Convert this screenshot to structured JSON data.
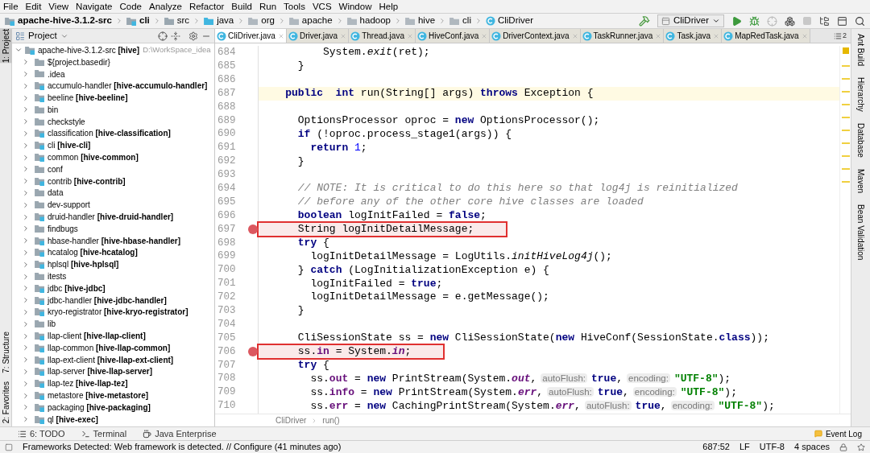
{
  "menu": [
    "File",
    "Edit",
    "View",
    "Navigate",
    "Code",
    "Analyze",
    "Refactor",
    "Build",
    "Run",
    "Tools",
    "VCS",
    "Window",
    "Help"
  ],
  "breadcrumb": [
    {
      "label": "apache-hive-3.1.2-src",
      "kind": "module",
      "bold": true
    },
    {
      "label": "cli",
      "kind": "module",
      "bold": true
    },
    {
      "label": "src",
      "kind": "folder",
      "bold": false
    },
    {
      "label": "java",
      "kind": "source",
      "bold": false
    },
    {
      "label": "org",
      "kind": "package",
      "bold": false
    },
    {
      "label": "apache",
      "kind": "package",
      "bold": false
    },
    {
      "label": "hadoop",
      "kind": "package",
      "bold": false
    },
    {
      "label": "hive",
      "kind": "package",
      "bold": false
    },
    {
      "label": "cli",
      "kind": "package",
      "bold": false
    },
    {
      "label": "CliDriver",
      "kind": "class",
      "bold": false
    }
  ],
  "run_config": "CliDriver",
  "left_strip": {
    "top": [
      {
        "label": "1: Project",
        "selected": true
      }
    ],
    "bottom": [
      {
        "label": "7: Structure",
        "selected": false
      },
      {
        "label": "2: Favorites",
        "selected": false
      }
    ]
  },
  "project_panel": {
    "title": "Project",
    "tree": {
      "name": "apache-hive-3.1.2-src",
      "module": "[hive]",
      "path": "D:\\WorkSpace_idea",
      "expanded": true,
      "children": [
        {
          "name": "${project.basedir}",
          "kind": "folder"
        },
        {
          "name": ".idea",
          "kind": "folder"
        },
        {
          "name": "accumulo-handler",
          "module": "[hive-accumulo-handler]",
          "kind": "module"
        },
        {
          "name": "beeline",
          "module": "[hive-beeline]",
          "kind": "module"
        },
        {
          "name": "bin",
          "kind": "folder"
        },
        {
          "name": "checkstyle",
          "kind": "folder"
        },
        {
          "name": "classification",
          "module": "[hive-classification]",
          "kind": "module"
        },
        {
          "name": "cli",
          "module": "[hive-cli]",
          "kind": "module"
        },
        {
          "name": "common",
          "module": "[hive-common]",
          "kind": "module"
        },
        {
          "name": "conf",
          "kind": "folder"
        },
        {
          "name": "contrib",
          "module": "[hive-contrib]",
          "kind": "module"
        },
        {
          "name": "data",
          "kind": "folder"
        },
        {
          "name": "dev-support",
          "kind": "folder"
        },
        {
          "name": "druid-handler",
          "module": "[hive-druid-handler]",
          "kind": "module"
        },
        {
          "name": "findbugs",
          "kind": "folder"
        },
        {
          "name": "hbase-handler",
          "module": "[hive-hbase-handler]",
          "kind": "module"
        },
        {
          "name": "hcatalog",
          "module": "[hive-hcatalog]",
          "kind": "module"
        },
        {
          "name": "hplsql",
          "module": "[hive-hplsql]",
          "kind": "module"
        },
        {
          "name": "itests",
          "kind": "folder"
        },
        {
          "name": "jdbc",
          "module": "[hive-jdbc]",
          "kind": "module"
        },
        {
          "name": "jdbc-handler",
          "module": "[hive-jdbc-handler]",
          "kind": "module"
        },
        {
          "name": "kryo-registrator",
          "module": "[hive-kryo-registrator]",
          "kind": "module"
        },
        {
          "name": "lib",
          "kind": "folder"
        },
        {
          "name": "llap-client",
          "module": "[hive-llap-client]",
          "kind": "module"
        },
        {
          "name": "llap-common",
          "module": "[hive-llap-common]",
          "kind": "module"
        },
        {
          "name": "llap-ext-client",
          "module": "[hive-llap-ext-client]",
          "kind": "module"
        },
        {
          "name": "llap-server",
          "module": "[hive-llap-server]",
          "kind": "module"
        },
        {
          "name": "llap-tez",
          "module": "[hive-llap-tez]",
          "kind": "module"
        },
        {
          "name": "metastore",
          "module": "[hive-metastore]",
          "kind": "module"
        },
        {
          "name": "packaging",
          "module": "[hive-packaging]",
          "kind": "module"
        },
        {
          "name": "ql",
          "module": "[hive-exec]",
          "kind": "module"
        }
      ]
    }
  },
  "editor_tabs": [
    {
      "label": "CliDriver.java",
      "selected": true
    },
    {
      "label": "Driver.java",
      "selected": false
    },
    {
      "label": "Thread.java",
      "selected": false
    },
    {
      "label": "HiveConf.java",
      "selected": false
    },
    {
      "label": "DriverContext.java",
      "selected": false
    },
    {
      "label": "TaskRunner.java",
      "selected": false
    },
    {
      "label": "Task.java",
      "selected": false
    },
    {
      "label": "MapRedTask.java",
      "selected": false
    }
  ],
  "tab_overflow": "2",
  "code": [
    {
      "number": "684",
      "breakpoint": false,
      "current": false,
      "tokens": [
        {
          "kind": "plain",
          "text": "          System."
        },
        {
          "kind": "static",
          "text": "exit"
        },
        {
          "kind": "plain",
          "text": "(ret);"
        }
      ]
    },
    {
      "number": "685",
      "breakpoint": false,
      "current": false,
      "tokens": [
        {
          "kind": "plain",
          "text": "      }"
        }
      ]
    },
    {
      "number": "686",
      "breakpoint": false,
      "current": false
    },
    {
      "number": "687",
      "breakpoint": false,
      "current": true,
      "tokens": [
        {
          "kind": "keyword",
          "text": "    public"
        },
        {
          "kind": "keyword",
          "text": "  int"
        },
        {
          "kind": "plain",
          "text": " run(String[] args) "
        },
        {
          "kind": "keyword",
          "text": "throws"
        },
        {
          "kind": "plain",
          "text": " Exception {"
        }
      ]
    },
    {
      "number": "688",
      "breakpoint": false,
      "current": false
    },
    {
      "number": "689",
      "breakpoint": false,
      "current": false,
      "tokens": [
        {
          "kind": "plain",
          "text": "      OptionsProcessor oproc = "
        },
        {
          "kind": "keyword",
          "text": "new"
        },
        {
          "kind": "plain",
          "text": " OptionsProcessor();"
        }
      ]
    },
    {
      "number": "690",
      "breakpoint": false,
      "current": false,
      "tokens": [
        {
          "kind": "keyword",
          "text": "      if"
        },
        {
          "kind": "plain",
          "text": " (!oproc.process_stage1(args)) {"
        }
      ]
    },
    {
      "number": "691",
      "breakpoint": false,
      "current": false,
      "tokens": [
        {
          "kind": "keyword",
          "text": "        return"
        },
        {
          "kind": "number",
          "text": " 1"
        },
        {
          "kind": "plain",
          "text": ";"
        }
      ]
    },
    {
      "number": "692",
      "breakpoint": false,
      "current": false,
      "tokens": [
        {
          "kind": "plain",
          "text": "      }"
        }
      ]
    },
    {
      "number": "693",
      "breakpoint": false,
      "current": false
    },
    {
      "number": "694",
      "breakpoint": false,
      "current": false,
      "tokens": [
        {
          "kind": "comment",
          "text": "      // NOTE: It is critical to do this here so that log4j is reinitialized"
        }
      ]
    },
    {
      "number": "695",
      "breakpoint": false,
      "current": false,
      "tokens": [
        {
          "kind": "comment",
          "text": "      // before any of the other core hive classes are loaded"
        }
      ]
    },
    {
      "number": "696",
      "breakpoint": false,
      "current": false,
      "tokens": [
        {
          "kind": "keyword",
          "text": "      boolean"
        },
        {
          "kind": "plain",
          "text": " logInitFailed = "
        },
        {
          "kind": "keyword",
          "text": "false"
        },
        {
          "kind": "plain",
          "text": ";"
        }
      ]
    },
    {
      "number": "697",
      "breakpoint": true,
      "current": false,
      "tokens": [
        {
          "kind": "plain",
          "text": "      String logInitDetailMessage;"
        }
      ]
    },
    {
      "number": "698",
      "breakpoint": false,
      "current": false,
      "tokens": [
        {
          "kind": "keyword",
          "text": "      try"
        },
        {
          "kind": "plain",
          "text": " {"
        }
      ]
    },
    {
      "number": "699",
      "breakpoint": false,
      "current": false,
      "tokens": [
        {
          "kind": "plain",
          "text": "        logInitDetailMessage = LogUtils."
        },
        {
          "kind": "static",
          "text": "initHiveLog4j"
        },
        {
          "kind": "plain",
          "text": "();"
        }
      ]
    },
    {
      "number": "700",
      "breakpoint": false,
      "current": false,
      "tokens": [
        {
          "kind": "plain",
          "text": "      } "
        },
        {
          "kind": "keyword",
          "text": "catch"
        },
        {
          "kind": "plain",
          "text": " (LogInitializationException e) {"
        }
      ]
    },
    {
      "number": "701",
      "breakpoint": false,
      "current": false,
      "tokens": [
        {
          "kind": "plain",
          "text": "        logInitFailed = "
        },
        {
          "kind": "keyword",
          "text": "true"
        },
        {
          "kind": "plain",
          "text": ";"
        }
      ]
    },
    {
      "number": "702",
      "breakpoint": false,
      "current": false,
      "tokens": [
        {
          "kind": "plain",
          "text": "        logInitDetailMessage = e.getMessage();"
        }
      ]
    },
    {
      "number": "703",
      "breakpoint": false,
      "current": false,
      "tokens": [
        {
          "kind": "plain",
          "text": "      }"
        }
      ]
    },
    {
      "number": "704",
      "breakpoint": false,
      "current": false
    },
    {
      "number": "705",
      "breakpoint": false,
      "current": false,
      "tokens": [
        {
          "kind": "plain",
          "text": "      CliSessionState ss = "
        },
        {
          "kind": "keyword",
          "text": "new"
        },
        {
          "kind": "plain",
          "text": " CliSessionState("
        },
        {
          "kind": "keyword",
          "text": "new"
        },
        {
          "kind": "plain",
          "text": " HiveConf(SessionState."
        },
        {
          "kind": "keyword",
          "text": "class"
        },
        {
          "kind": "plain",
          "text": "));"
        }
      ]
    },
    {
      "number": "706",
      "breakpoint": true,
      "current": false,
      "tokens": [
        {
          "kind": "plain",
          "text": "      ss."
        },
        {
          "kind": "field",
          "text": "in"
        },
        {
          "kind": "plain",
          "text": " = System."
        },
        {
          "kind": "static_field",
          "text": "in"
        },
        {
          "kind": "plain",
          "text": ";"
        }
      ]
    },
    {
      "number": "707",
      "breakpoint": false,
      "current": false,
      "tokens": [
        {
          "kind": "keyword",
          "text": "      try"
        },
        {
          "kind": "plain",
          "text": " {"
        }
      ]
    },
    {
      "number": "708",
      "breakpoint": false,
      "current": false,
      "tokens": [
        {
          "kind": "plain",
          "text": "        ss."
        },
        {
          "kind": "field",
          "text": "out"
        },
        {
          "kind": "plain",
          "text": " = "
        },
        {
          "kind": "keyword",
          "text": "new"
        },
        {
          "kind": "plain",
          "text": " PrintStream(System."
        },
        {
          "kind": "static_field",
          "text": "out"
        },
        {
          "kind": "plain",
          "text": ","
        },
        {
          "kind": "hint",
          "text": "autoFlush:"
        },
        {
          "kind": "keyword",
          "text": "true"
        },
        {
          "kind": "plain",
          "text": ","
        },
        {
          "kind": "hint",
          "text": "encoding:"
        },
        {
          "kind": "string",
          "text": "\"UTF-8\""
        },
        {
          "kind": "plain",
          "text": ");"
        }
      ]
    },
    {
      "number": "709",
      "breakpoint": false,
      "current": false,
      "tokens": [
        {
          "kind": "plain",
          "text": "        ss."
        },
        {
          "kind": "field",
          "text": "info"
        },
        {
          "kind": "plain",
          "text": " = "
        },
        {
          "kind": "keyword",
          "text": "new"
        },
        {
          "kind": "plain",
          "text": " PrintStream(System."
        },
        {
          "kind": "static_field",
          "text": "err"
        },
        {
          "kind": "plain",
          "text": ","
        },
        {
          "kind": "hint",
          "text": "autoFlush:"
        },
        {
          "kind": "keyword",
          "text": "true"
        },
        {
          "kind": "plain",
          "text": ","
        },
        {
          "kind": "hint",
          "text": "encoding:"
        },
        {
          "kind": "string",
          "text": "\"UTF-8\""
        },
        {
          "kind": "plain",
          "text": ");"
        }
      ]
    },
    {
      "number": "710",
      "breakpoint": false,
      "current": false,
      "tokens": [
        {
          "kind": "plain",
          "text": "        ss."
        },
        {
          "kind": "field",
          "text": "err"
        },
        {
          "kind": "plain",
          "text": " = "
        },
        {
          "kind": "keyword",
          "text": "new"
        },
        {
          "kind": "plain",
          "text": " CachingPrintStream(System."
        },
        {
          "kind": "static_field",
          "text": "err"
        },
        {
          "kind": "plain",
          "text": ","
        },
        {
          "kind": "hint",
          "text": "autoFlush:"
        },
        {
          "kind": "keyword",
          "text": "true"
        },
        {
          "kind": "plain",
          "text": ","
        },
        {
          "kind": "hint",
          "text": "encoding:"
        },
        {
          "kind": "string",
          "text": "\"UTF-8\""
        },
        {
          "kind": "plain",
          "text": ");"
        }
      ]
    }
  ],
  "editor_breadcrumb": [
    "CliDriver",
    "run()"
  ],
  "right_strip": [
    "Ant Build",
    "Hierarchy",
    "Database",
    "Maven",
    "Bean Validation"
  ],
  "bottom_tools": [
    "6: TODO",
    "Terminal",
    "Java Enterprise"
  ],
  "event_log": "Event Log",
  "status_bar": {
    "message": "Frameworks Detected: Web framework is detected. // Configure (41 minutes ago)",
    "position": "687:52",
    "line_separator": "LF",
    "encoding": "UTF-8",
    "indent": "4 spaces"
  }
}
